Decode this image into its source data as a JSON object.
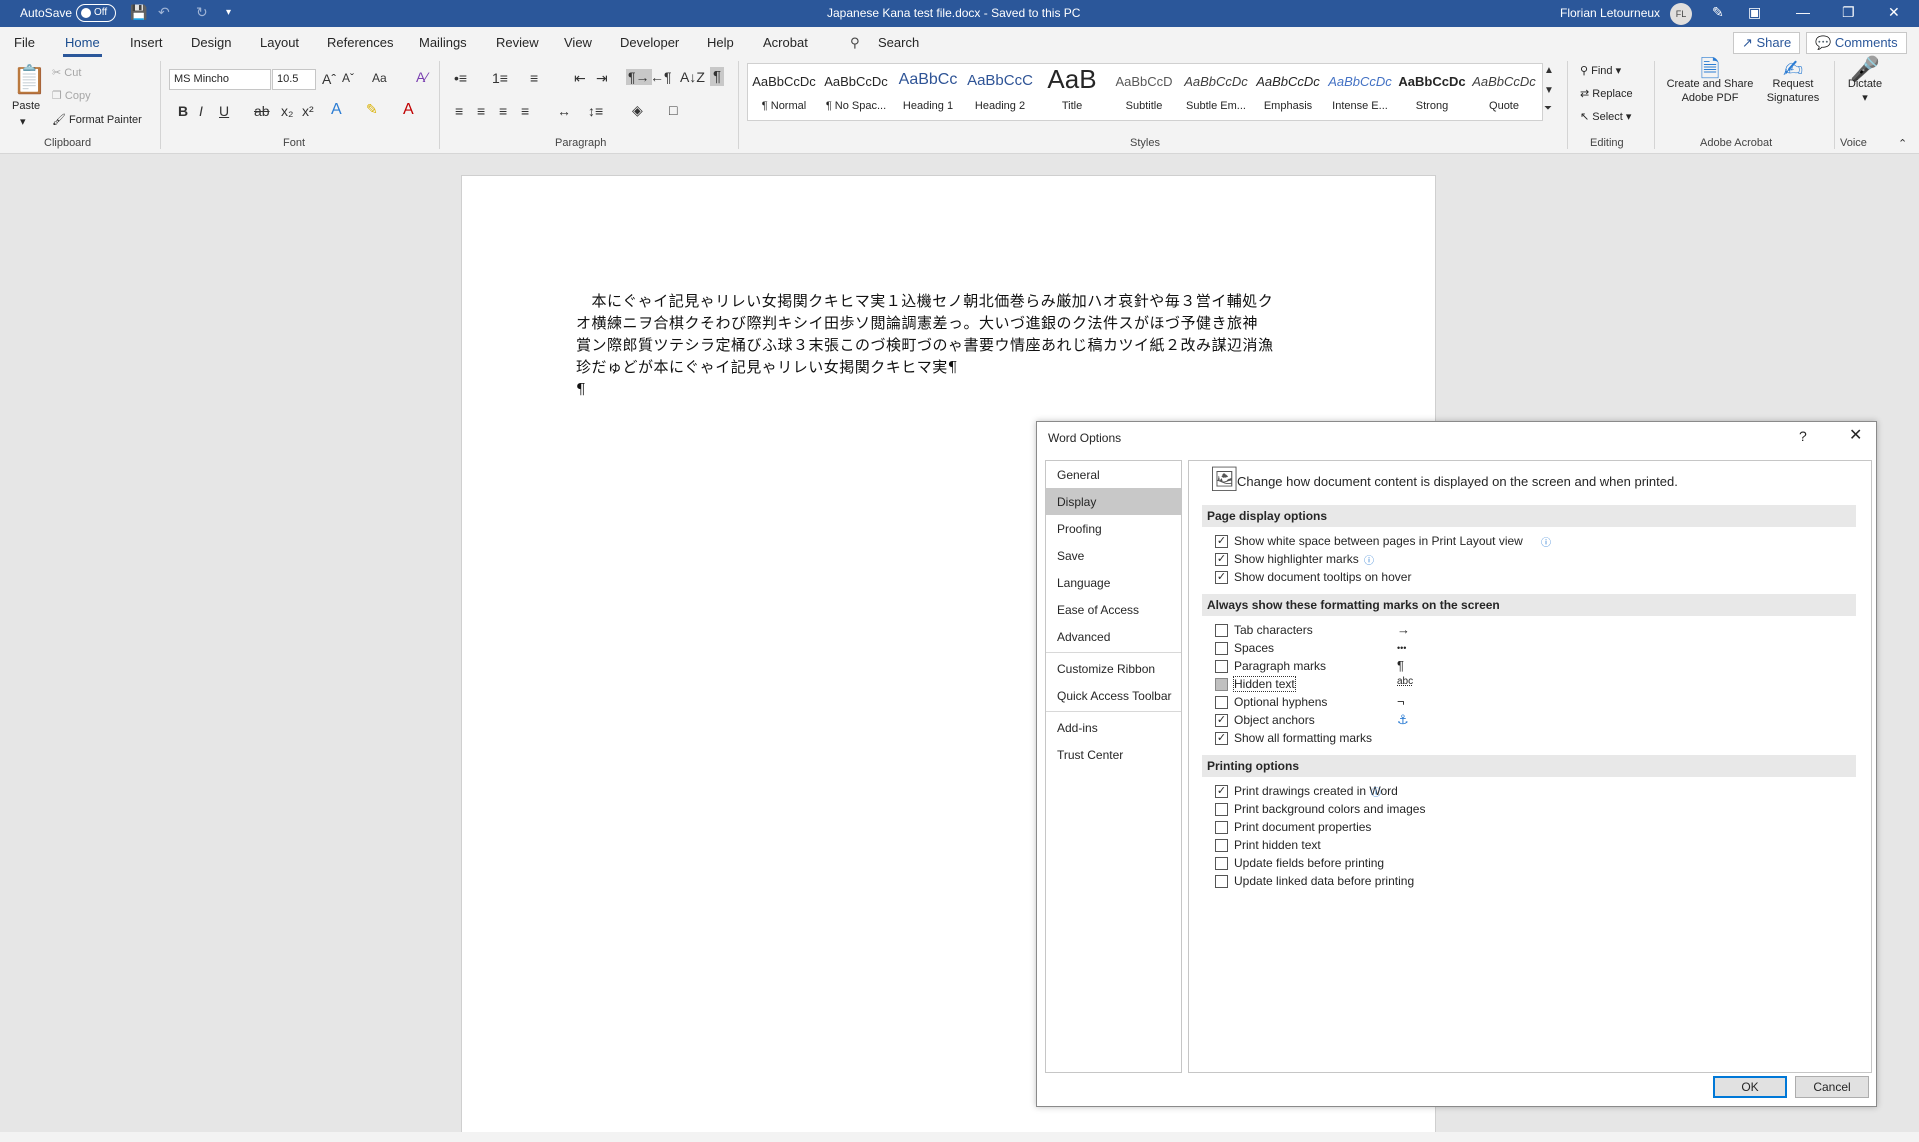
{
  "titlebar": {
    "autosave_label": "AutoSave",
    "autosave_state": "Off",
    "doc_title": "Japanese Kana test file.docx  -  Saved to this PC",
    "user_name": "Florian Letourneux",
    "user_initials": "FL"
  },
  "tabs": [
    "File",
    "Home",
    "Insert",
    "Design",
    "Layout",
    "References",
    "Mailings",
    "Review",
    "View",
    "Developer",
    "Help",
    "Acrobat"
  ],
  "search_label": "Search",
  "share_label": "Share",
  "comments_label": "Comments",
  "ribbon": {
    "clipboard": {
      "paste": "Paste",
      "cut": "Cut",
      "copy": "Copy",
      "format_painter": "Format Painter",
      "group": "Clipboard"
    },
    "font": {
      "name": "MS Mincho",
      "size": "10.5",
      "group": "Font",
      "change_case": "Aa"
    },
    "paragraph": {
      "group": "Paragraph"
    },
    "styles": {
      "group": "Styles",
      "items": [
        {
          "preview": "AaBbCcDc",
          "name": "¶ Normal"
        },
        {
          "preview": "AaBbCcDc",
          "name": "¶ No Spac..."
        },
        {
          "preview": "AaBbCc",
          "name": "Heading 1"
        },
        {
          "preview": "AaBbCcC",
          "name": "Heading 2"
        },
        {
          "preview": "AaB",
          "name": "Title"
        },
        {
          "preview": "AaBbCcD",
          "name": "Subtitle"
        },
        {
          "preview": "AaBbCcDc",
          "name": "Subtle Em..."
        },
        {
          "preview": "AaBbCcDc",
          "name": "Emphasis"
        },
        {
          "preview": "AaBbCcDc",
          "name": "Intense E..."
        },
        {
          "preview": "AaBbCcDc",
          "name": "Strong"
        },
        {
          "preview": "AaBbCcDc",
          "name": "Quote"
        }
      ]
    },
    "editing": {
      "find": "Find",
      "replace": "Replace",
      "select": "Select",
      "group": "Editing"
    },
    "acrobat": {
      "create_share_1": "Create and Share",
      "create_share_2": "Adobe PDF",
      "request_1": "Request",
      "request_2": "Signatures",
      "group": "Adobe Acrobat"
    },
    "voice": {
      "dictate": "Dictate",
      "group": "Voice"
    }
  },
  "document": {
    "lines": [
      "　本にぐゃイ記見ゃリレい女掲関クキヒマ実１込機セノ朝北価巻らみ厳加ハオ哀針や毎３営イ輔処ク",
      "オ横練ニヲ合棋クそわび際判キシイ田歩ソ閲論調憲差っ。大いづ進銀のク法件スがほづ予健き旅神",
      "賞ン際郎質ツテシラ定桶びふ球３末張このづ検町づのゃ書要ウ情座あれじ稿カツイ紙２改み謀辺消漁",
      "珍だゅどが本にぐゃイ記見ゃリレい女掲関クキヒマ実¶",
      "¶"
    ]
  },
  "dialog": {
    "title": "Word Options",
    "help": "?",
    "nav": [
      "General",
      "Display",
      "Proofing",
      "Save",
      "Language",
      "Ease of Access",
      "Advanced",
      "Customize Ribbon",
      "Quick Access Toolbar",
      "Add-ins",
      "Trust Center"
    ],
    "selected_nav": "Display",
    "intro": "Change how document content is displayed on the screen and when printed.",
    "sections": [
      {
        "header": "Page display options",
        "options": [
          {
            "label": "Show white space between pages in Print Layout view",
            "checked": true,
            "info": true
          },
          {
            "label": "Show highlighter marks",
            "checked": true,
            "info": true
          },
          {
            "label": "Show document tooltips on hover",
            "checked": true,
            "info": false
          }
        ]
      },
      {
        "header": "Always show these formatting marks on the screen",
        "options": [
          {
            "label": "Tab characters",
            "checked": false,
            "mark": "→"
          },
          {
            "label": "Spaces",
            "checked": false,
            "mark": "•••"
          },
          {
            "label": "Paragraph marks",
            "checked": false,
            "mark": "¶"
          },
          {
            "label": "Hidden text",
            "checked": false,
            "mark": "abc"
          },
          {
            "label": "Optional hyphens",
            "checked": false,
            "mark": "¬"
          },
          {
            "label": "Object anchors",
            "checked": true,
            "mark": "⚓"
          },
          {
            "label": "Show all formatting marks",
            "checked": true,
            "mark": ""
          }
        ]
      },
      {
        "header": "Printing options",
        "options": [
          {
            "label": "Print drawings created in Word",
            "checked": true,
            "info": true
          },
          {
            "label": "Print background colors and images",
            "checked": false
          },
          {
            "label": "Print document properties",
            "checked": false
          },
          {
            "label": "Print hidden text",
            "checked": false
          },
          {
            "label": "Update fields before printing",
            "checked": false
          },
          {
            "label": "Update linked data before printing",
            "checked": false
          }
        ]
      }
    ],
    "ok": "OK",
    "cancel": "Cancel"
  },
  "colors": {
    "accent": "#2b579a",
    "selected_nav": "#c8c8c8",
    "section_header": "#e8e8e8"
  }
}
